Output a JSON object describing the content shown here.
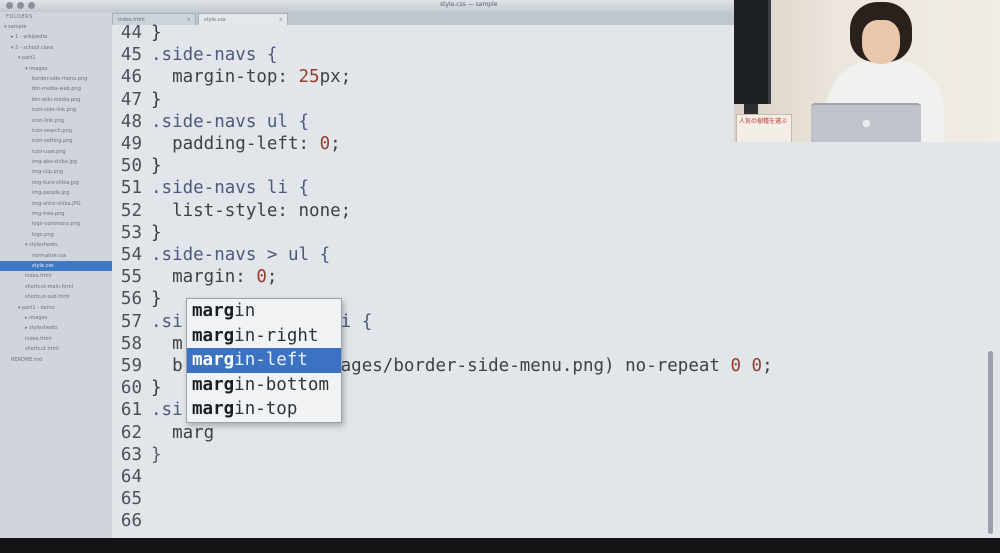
{
  "window": {
    "title": "style.css — sample"
  },
  "sidebar": {
    "header": "FOLDERS",
    "items": [
      {
        "label": "▾ sample",
        "indent": 0
      },
      {
        "label": "▸ 1 - wikipedia",
        "indent": 1
      },
      {
        "label": "▾ 2 - school class",
        "indent": 1
      },
      {
        "label": "▾ part1",
        "indent": 2
      },
      {
        "label": "▾ images",
        "indent": 3
      },
      {
        "label": "border-side-menu.png",
        "indent": 4
      },
      {
        "label": "btn-media-web.png",
        "indent": 4
      },
      {
        "label": "btn-wiki-media.png",
        "indent": 4
      },
      {
        "label": "icon-side-link.png",
        "indent": 4
      },
      {
        "label": "icon-link.png",
        "indent": 4
      },
      {
        "label": "icon-search.png",
        "indent": 4
      },
      {
        "label": "icon-setting.png",
        "indent": 4
      },
      {
        "label": "icon-user.png",
        "indent": 4
      },
      {
        "label": "img-abe-shiba.jpg",
        "indent": 4
      },
      {
        "label": "img-clip.png",
        "indent": 4
      },
      {
        "label": "img-kuro-shiba.jpg",
        "indent": 4
      },
      {
        "label": "img-people.jpg",
        "indent": 4
      },
      {
        "label": "img-shiro-shiba.JPG",
        "indent": 4
      },
      {
        "label": "img-tree.png",
        "indent": 4
      },
      {
        "label": "logo-commons.png",
        "indent": 4
      },
      {
        "label": "logo.png",
        "indent": 4
      },
      {
        "label": "▾ stylesheets",
        "indent": 3
      },
      {
        "label": "normalize.css",
        "indent": 4
      },
      {
        "label": "style.css",
        "indent": 4,
        "selected": true
      },
      {
        "label": "index.html",
        "indent": 3
      },
      {
        "label": "shortcut-main.html",
        "indent": 3
      },
      {
        "label": "shortcut-sub.html",
        "indent": 3
      },
      {
        "label": "▾ part1 - demo",
        "indent": 2
      },
      {
        "label": "▸ images",
        "indent": 3
      },
      {
        "label": "▸ stylesheets",
        "indent": 3
      },
      {
        "label": "index.html",
        "indent": 3
      },
      {
        "label": "shortcut.html",
        "indent": 3
      },
      {
        "label": "README.md",
        "indent": 1
      }
    ]
  },
  "tabs": [
    {
      "label": "index.html",
      "close": "×",
      "active": false
    },
    {
      "label": "style.css",
      "close": "×",
      "active": true
    }
  ],
  "editor": {
    "lines": [
      {
        "num": "44",
        "tokens": [
          {
            "t": "}",
            "c": "plain"
          }
        ]
      },
      {
        "num": "45",
        "tokens": [
          {
            "t": ".side-navs {",
            "c": "sel"
          }
        ]
      },
      {
        "num": "46",
        "tokens": [
          {
            "t": "  margin-top: ",
            "c": "prop"
          },
          {
            "t": "25",
            "c": "num"
          },
          {
            "t": "px;",
            "c": "prop"
          }
        ]
      },
      {
        "num": "47",
        "tokens": [
          {
            "t": "}",
            "c": "plain"
          }
        ]
      },
      {
        "num": "48",
        "tokens": [
          {
            "t": ".side-navs ul {",
            "c": "sel"
          }
        ]
      },
      {
        "num": "49",
        "tokens": [
          {
            "t": "  padding-left: ",
            "c": "prop"
          },
          {
            "t": "0",
            "c": "num"
          },
          {
            "t": ";",
            "c": "prop"
          }
        ]
      },
      {
        "num": "50",
        "tokens": [
          {
            "t": "}",
            "c": "plain"
          }
        ]
      },
      {
        "num": "51",
        "tokens": [
          {
            "t": ".side-navs li {",
            "c": "sel"
          }
        ]
      },
      {
        "num": "52",
        "tokens": [
          {
            "t": "  list-style: none;",
            "c": "prop"
          }
        ]
      },
      {
        "num": "53",
        "tokens": [
          {
            "t": "}",
            "c": "plain"
          }
        ]
      },
      {
        "num": "54",
        "tokens": [
          {
            "t": ".side-navs > ul {",
            "c": "sel"
          }
        ]
      },
      {
        "num": "55",
        "tokens": [
          {
            "t": "  margin: ",
            "c": "prop"
          },
          {
            "t": "0",
            "c": "num"
          },
          {
            "t": ";",
            "c": "prop"
          }
        ]
      },
      {
        "num": "56",
        "tokens": [
          {
            "t": "}",
            "c": "plain"
          }
        ]
      },
      {
        "num": "57",
        "tokens": [
          {
            "t": ".si",
            "c": "sel"
          },
          {
            "t": "         li + li {",
            "c": "sel"
          }
        ]
      },
      {
        "num": "58",
        "tokens": [
          {
            "t": "  m",
            "c": "prop"
          },
          {
            "t": "         ;",
            "c": "prop"
          }
        ]
      },
      {
        "num": "59",
        "tokens": [
          {
            "t": "  b",
            "c": "prop"
          },
          {
            "t": "         (../images/border-side-menu.png) no-repeat ",
            "c": "prop"
          },
          {
            "t": "0 0",
            "c": "num"
          },
          {
            "t": ";",
            "c": "prop"
          }
        ]
      },
      {
        "num": "60",
        "tokens": [
          {
            "t": "}",
            "c": "plain"
          }
        ]
      },
      {
        "num": "61",
        "tokens": [
          {
            "t": ".si",
            "c": "sel"
          },
          {
            "t": "         {",
            "c": "fold"
          }
        ]
      },
      {
        "num": "62",
        "tokens": [
          {
            "t": "  marg",
            "c": "prop"
          }
        ]
      },
      {
        "num": "63",
        "tokens": [
          {
            "t": "}",
            "c": "fold"
          }
        ]
      },
      {
        "num": "64",
        "tokens": []
      },
      {
        "num": "65",
        "tokens": []
      },
      {
        "num": "66",
        "tokens": []
      }
    ]
  },
  "autocomplete": {
    "typed": "marg",
    "items": [
      {
        "match": "marg",
        "rest": "in",
        "active": false
      },
      {
        "match": "marg",
        "rest": "in-right",
        "active": false
      },
      {
        "match": "marg",
        "rest": "in-left",
        "active": true
      },
      {
        "match": "marg",
        "rest": "in-bottom",
        "active": false
      },
      {
        "match": "marg",
        "rest": "in-top",
        "active": false
      }
    ]
  },
  "colors": {
    "editor_bg": "#e2e6ea",
    "selection": "#3c72c2",
    "number": "#9b3a2c",
    "selector": "#4b5a7d"
  },
  "webcam": {
    "sign_text": "人気の樹種を選ぶ"
  }
}
